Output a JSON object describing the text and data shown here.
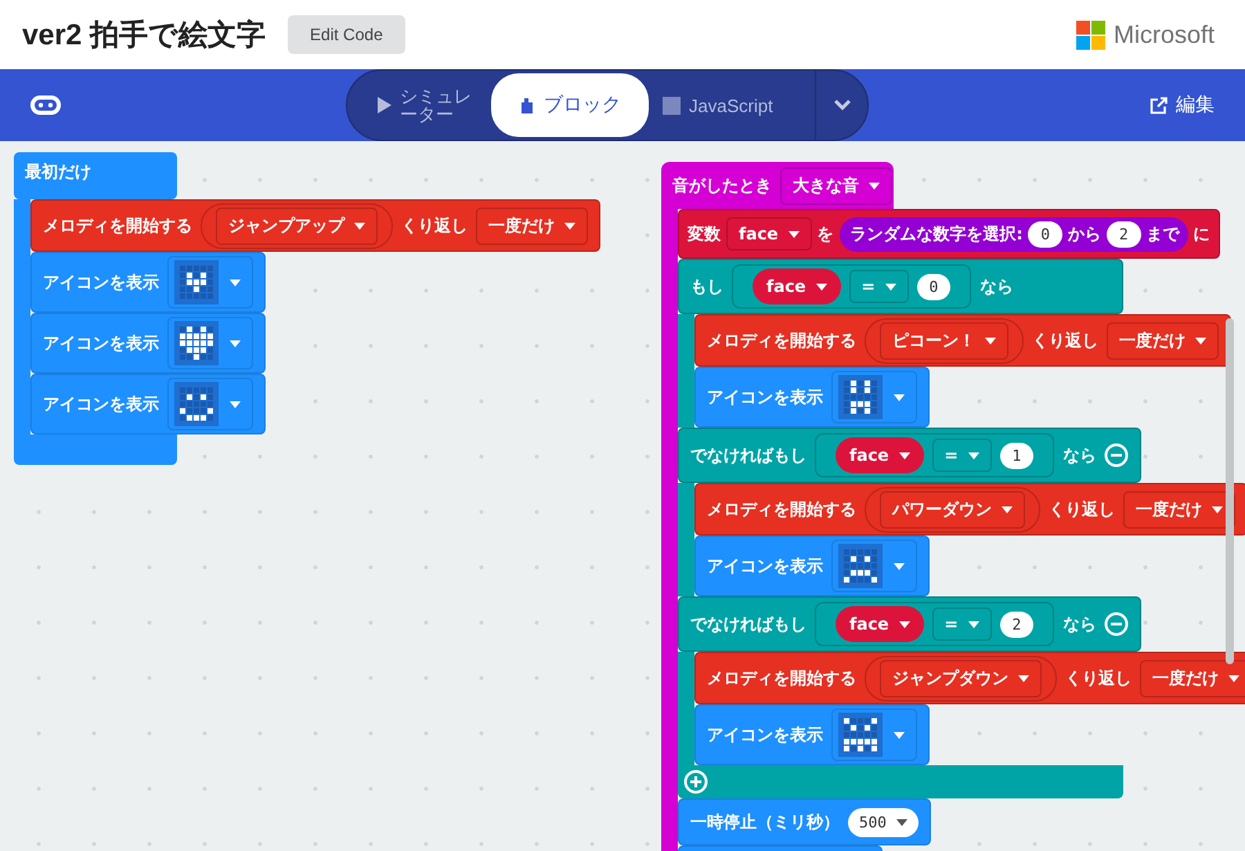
{
  "header": {
    "title": "ver2 拍手で絵文字",
    "edit_button": "Edit Code",
    "brand": "Microsoft"
  },
  "toolbar": {
    "tabs": [
      {
        "label": "シミュレーター",
        "kind": "simulator",
        "selected": false
      },
      {
        "label": "ブロック",
        "kind": "blocks",
        "selected": true
      },
      {
        "label": "JavaScript",
        "kind": "javascript",
        "selected": false
      }
    ],
    "edit_link": "編集"
  },
  "workspace": {
    "stacks": [
      {
        "kind": "basic_event",
        "label": "最初だけ",
        "body": [
          {
            "kind": "melody",
            "label": "メロディを開始する",
            "melody": "ジャンプアップ",
            "repeat_label": "くり返し",
            "repeat": "一度だけ"
          },
          {
            "kind": "show_icon",
            "label": "アイコンを表示",
            "leds": [
              [
                false,
                false,
                false,
                false,
                false
              ],
              [
                false,
                true,
                false,
                true,
                false
              ],
              [
                false,
                true,
                true,
                true,
                false
              ],
              [
                false,
                false,
                true,
                false,
                false
              ],
              [
                false,
                false,
                false,
                false,
                false
              ]
            ]
          },
          {
            "kind": "show_icon",
            "label": "アイコンを表示",
            "leds": [
              [
                false,
                true,
                false,
                true,
                false
              ],
              [
                true,
                true,
                true,
                true,
                true
              ],
              [
                true,
                true,
                true,
                true,
                true
              ],
              [
                false,
                true,
                true,
                true,
                false
              ],
              [
                false,
                false,
                true,
                false,
                false
              ]
            ]
          },
          {
            "kind": "show_icon",
            "label": "アイコンを表示",
            "leds": [
              [
                false,
                false,
                false,
                false,
                false
              ],
              [
                false,
                true,
                false,
                true,
                false
              ],
              [
                false,
                false,
                false,
                false,
                false
              ],
              [
                true,
                false,
                false,
                false,
                true
              ],
              [
                false,
                true,
                true,
                true,
                false
              ]
            ]
          }
        ]
      },
      {
        "kind": "input_event",
        "label": "音がしたとき",
        "option": "大きな音",
        "body": [
          {
            "kind": "set_variable",
            "label": "変数",
            "variable": "face",
            "assign_label": "を",
            "random_label": "ランダムな数字を選択:",
            "from": "0",
            "from_label": "から",
            "to": "2",
            "to_label": "まで",
            "suffix": "に"
          },
          {
            "kind": "if",
            "clauses": [
              {
                "label": "もし",
                "variable": "face",
                "operator": "=",
                "value": "0",
                "then_label": "なら",
                "removable": false,
                "body": [
                  {
                    "kind": "melody",
                    "label": "メロディを開始する",
                    "melody": "ピコーン！",
                    "repeat_label": "くり返し",
                    "repeat": "一度だけ"
                  },
                  {
                    "kind": "show_icon",
                    "label": "アイコンを表示",
                    "leds": [
                      [
                        false,
                        true,
                        false,
                        true,
                        false
                      ],
                      [
                        false,
                        true,
                        false,
                        true,
                        false
                      ],
                      [
                        false,
                        false,
                        false,
                        false,
                        false
                      ],
                      [
                        false,
                        true,
                        true,
                        true,
                        false
                      ],
                      [
                        false,
                        true,
                        false,
                        true,
                        false
                      ]
                    ]
                  }
                ]
              },
              {
                "label": "でなければもし",
                "variable": "face",
                "operator": "=",
                "value": "1",
                "then_label": "なら",
                "removable": true,
                "body": [
                  {
                    "kind": "melody",
                    "label": "メロディを開始する",
                    "melody": "パワーダウン",
                    "repeat_label": "くり返し",
                    "repeat": "一度だけ"
                  },
                  {
                    "kind": "show_icon",
                    "label": "アイコンを表示",
                    "leds": [
                      [
                        false,
                        false,
                        false,
                        false,
                        false
                      ],
                      [
                        false,
                        true,
                        false,
                        true,
                        false
                      ],
                      [
                        false,
                        false,
                        false,
                        false,
                        false
                      ],
                      [
                        false,
                        true,
                        true,
                        true,
                        false
                      ],
                      [
                        true,
                        false,
                        false,
                        false,
                        true
                      ]
                    ]
                  }
                ]
              },
              {
                "label": "でなければもし",
                "variable": "face",
                "operator": "=",
                "value": "2",
                "then_label": "なら",
                "removable": true,
                "body": [
                  {
                    "kind": "melody",
                    "label": "メロディを開始する",
                    "melody": "ジャンプダウン",
                    "repeat_label": "くり返し",
                    "repeat": "一度だけ"
                  },
                  {
                    "kind": "show_icon",
                    "label": "アイコンを表示",
                    "leds": [
                      [
                        true,
                        false,
                        false,
                        false,
                        true
                      ],
                      [
                        false,
                        true,
                        false,
                        true,
                        false
                      ],
                      [
                        false,
                        false,
                        false,
                        false,
                        false
                      ],
                      [
                        true,
                        true,
                        true,
                        true,
                        true
                      ],
                      [
                        true,
                        false,
                        true,
                        false,
                        true
                      ]
                    ]
                  }
                ]
              }
            ]
          },
          {
            "kind": "pause",
            "label": "一時停止（ミリ秒）",
            "value": "500"
          },
          {
            "kind": "cut_off"
          }
        ]
      }
    ]
  }
}
